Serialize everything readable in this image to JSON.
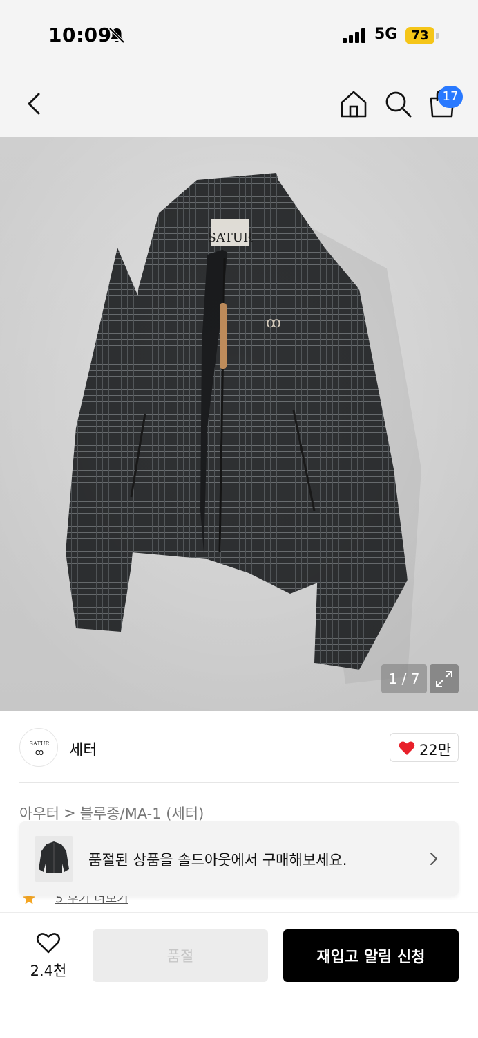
{
  "status": {
    "time": "10:09",
    "network": "5G",
    "battery": "73"
  },
  "nav": {
    "cart_count": "17"
  },
  "product": {
    "label_text": "SATUR",
    "image_counter": "1 / 7"
  },
  "brand": {
    "logo_text": "SATUR",
    "name": "세터",
    "likes": "22만"
  },
  "breadcrumb": {
    "category": "아우터",
    "separator": ">",
    "subcategory": "블루종/MA-1 (세터)"
  },
  "rating": {
    "score": "5",
    "review_link": "후기 더보기"
  },
  "sold_banner": {
    "text": "품절된 상품을 솔드아웃에서 구매해보세요."
  },
  "bottom": {
    "wish_count": "2.4천",
    "soldout_label": "품절",
    "restock_label": "재입고 알림 신청"
  },
  "colors": {
    "badge": "#2979ff",
    "battery": "#f5c518",
    "like_heart": "#e8202a",
    "star": "#f5a623",
    "primary_button": "#000000"
  }
}
